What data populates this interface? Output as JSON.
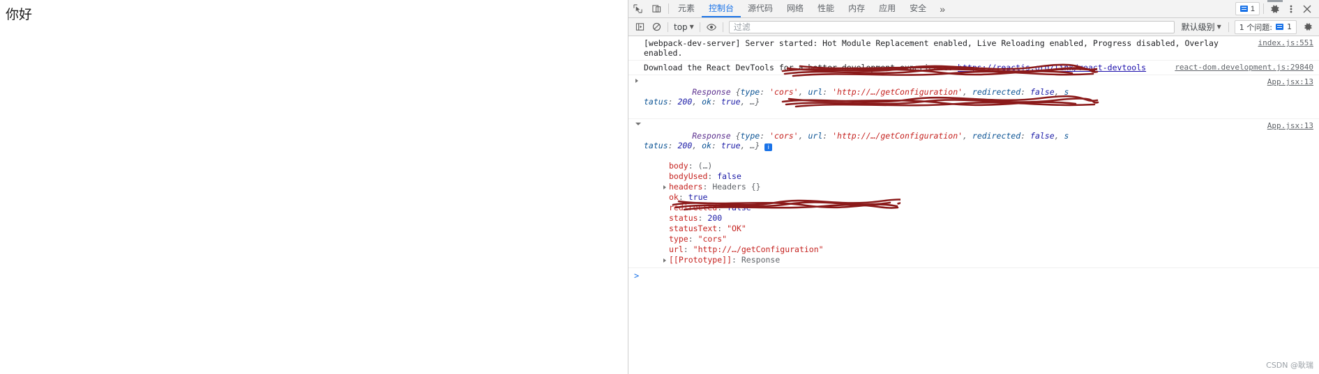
{
  "page": {
    "greeting": "你好"
  },
  "devtools": {
    "toolbar": {
      "inspect_icon": "inspect-element-icon",
      "device_icon": "device-toolbar-icon",
      "tabs": [
        {
          "label": "元素",
          "active": false
        },
        {
          "label": "控制台",
          "active": true
        },
        {
          "label": "源代码",
          "active": false
        },
        {
          "label": "网络",
          "active": false
        },
        {
          "label": "性能",
          "active": false
        },
        {
          "label": "内存",
          "active": false
        },
        {
          "label": "应用",
          "active": false
        },
        {
          "label": "安全",
          "active": false
        }
      ],
      "overflow_label": "»",
      "issues_count": "1",
      "settings_icon": "gear-icon",
      "more_icon": "kebab-menu-icon",
      "close_icon": "close-icon"
    },
    "console_toolbar": {
      "sidebar_icon": "console-sidebar-icon",
      "clear_icon": "clear-console-icon",
      "context_value": "top",
      "eye_icon": "live-expression-icon",
      "filter_placeholder": "过滤",
      "filter_value": "",
      "level_value": "默认级别",
      "issues_label": "1 个问题:",
      "issues_count": "1",
      "settings_icon": "console-settings-gear-icon"
    },
    "messages": [
      {
        "id": "webpack",
        "text": "[webpack-dev-server] Server started: Hot Module Replacement enabled, Live Reloading enabled, Progress disabled, Overlay enabled.",
        "source": "index.js:551"
      },
      {
        "id": "react-devtools",
        "text_before": "Download the React DevTools for a better development experience: ",
        "link": "https://reactjs.org/link/react-devtools",
        "source": "react-dom.development.js:29840"
      }
    ],
    "response_collapsed": {
      "head": "Response",
      "brace_open": "{",
      "k_type": "type",
      "v_type": "'cors'",
      "k_url": "url",
      "v_url_redacted": "'http://…/getConfiguration'",
      "k_redirected": "redirected",
      "v_redirected": "false",
      "tail_s": "s",
      "line2_prefix": "tatus",
      "line2_status": "200",
      "k_ok": "ok",
      "v_ok": "true",
      "ellipsis": "…}",
      "source": "App.jsx:13"
    },
    "response_expanded": {
      "head": "Response",
      "k_type": "type",
      "v_type": "'cors'",
      "k_url": "url",
      "v_url_redacted": "'http://…/getConfiguration'",
      "k_redirected": "redirected",
      "v_redirected": "false",
      "tail_s": "s",
      "line2_prefix": "tatus",
      "line2_status": "200",
      "k_ok": "ok",
      "v_ok": "true",
      "ellipsis": "…}",
      "source": "App.jsx:13",
      "properties": [
        {
          "key": "body",
          "value": "(…)",
          "value_kind": "gray",
          "expandable": false
        },
        {
          "key": "bodyUsed",
          "value": "false",
          "value_kind": "bool",
          "expandable": false
        },
        {
          "key": "headers",
          "value": "Headers {}",
          "value_kind": "gray",
          "expandable": true,
          "key_kind": "blue"
        },
        {
          "key": "ok",
          "value": "true",
          "value_kind": "bool",
          "expandable": false
        },
        {
          "key": "redirected",
          "value": "false",
          "value_kind": "bool",
          "expandable": false
        },
        {
          "key": "status",
          "value": "200",
          "value_kind": "num",
          "expandable": false
        },
        {
          "key": "statusText",
          "value": "\"OK\"",
          "value_kind": "str",
          "expandable": false
        },
        {
          "key": "type",
          "value": "\"cors\"",
          "value_kind": "str",
          "expandable": false
        },
        {
          "key": "url",
          "value": "\"http://…/getConfiguration\"",
          "value_kind": "str",
          "expandable": false,
          "redacted": true
        },
        {
          "key": "[[Prototype]]",
          "value": "Response",
          "value_kind": "gray",
          "expandable": true,
          "key_kind": "blue"
        }
      ]
    },
    "prompt": {
      "caret": ">",
      "value": ""
    }
  },
  "watermark": "CSDN @耿瑞",
  "colors": {
    "accent": "#1a73e8",
    "toolbar_bg": "#f3f3f3",
    "border": "#cdcdcd",
    "link": "#1a0dab",
    "key_red": "#c5221f",
    "value_blue": "#1a1aa6",
    "object_purple": "#5b2f8e",
    "redaction": "#8b1a1a"
  }
}
